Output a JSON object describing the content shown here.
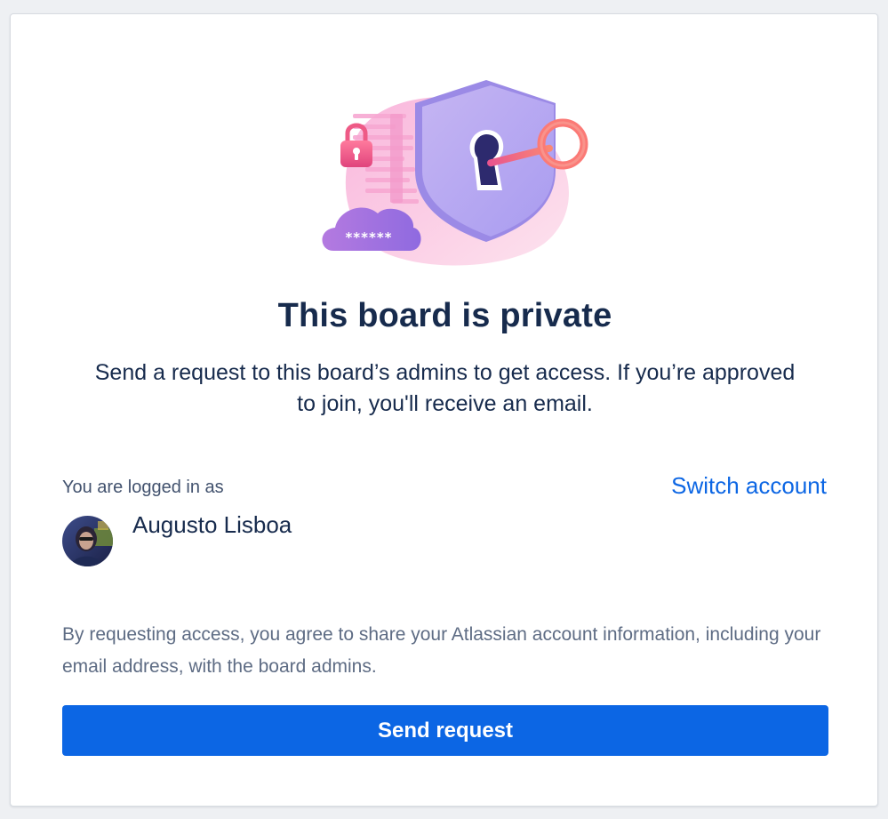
{
  "dialog": {
    "title": "This board is private",
    "description": "Send a request to this board’s admins to get access. If you’re approved to join, you'll receive an email.",
    "illustration": {
      "icons": [
        "shield-icon",
        "keyhole-icon",
        "key-icon",
        "padlock-icon",
        "cloud-password-icon"
      ],
      "password_mask": "******"
    },
    "account": {
      "logged_in_label": "You are logged in as",
      "switch_label": "Switch account",
      "user_name": "Augusto Lisboa"
    },
    "notice": "By requesting access, you agree to share your Atlassian account information, including your email address, with the board admins.",
    "send_label": "Send request"
  },
  "colors": {
    "accent": "#0c66e4",
    "heading": "#172b4d",
    "muted": "#5e6c84",
    "background": "#eef0f3"
  }
}
